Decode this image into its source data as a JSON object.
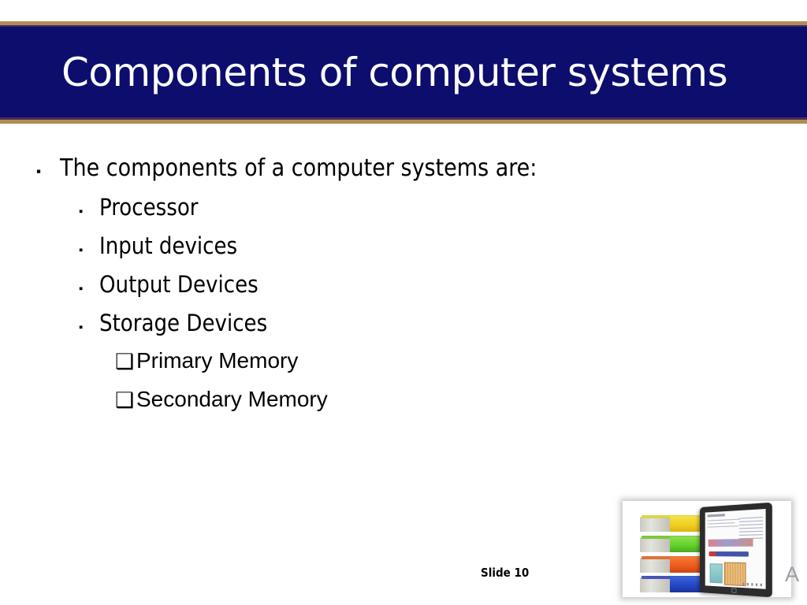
{
  "slide": {
    "title": "Components of computer systems",
    "slide_number_label": "Slide 10",
    "stray_letter": "A",
    "colors": {
      "banner_background": "#0d0d6e",
      "banner_border": "#b08d54",
      "title_text": "#ffffff",
      "body_text": "#000000",
      "slide_background": "#ffffff"
    }
  },
  "body": {
    "bullets": [
      {
        "level": 1,
        "marker": "square-bullet",
        "marker_glyph": "▪",
        "text": "The components of a computer systems are:"
      },
      {
        "level": 2,
        "marker": "square-bullet",
        "marker_glyph": "▪",
        "text": "Processor"
      },
      {
        "level": 2,
        "marker": "square-bullet",
        "marker_glyph": "▪",
        "text": "Input devices"
      },
      {
        "level": 2,
        "marker": "square-bullet",
        "marker_glyph": "▪",
        "text": "Output Devices"
      },
      {
        "level": 2,
        "marker": "square-bullet",
        "marker_glyph": "▪",
        "text": "Storage Devices"
      },
      {
        "level": 3,
        "marker": "shadowed-white-square-bullet",
        "marker_glyph": "❑",
        "text": "Primary Memory"
      },
      {
        "level": 3,
        "marker": "shadowed-white-square-bullet",
        "marker_glyph": "❑",
        "text": "Secondary Memory"
      }
    ]
  },
  "corner_image": {
    "description": "stack of books beside a tablet",
    "books": [
      {
        "name": "book-yellow",
        "color": "#f2cf20"
      },
      {
        "name": "book-green",
        "color": "#63d22c"
      },
      {
        "name": "book-orange",
        "color": "#ee5c1c"
      },
      {
        "name": "book-blue",
        "color": "#2346c9"
      }
    ],
    "tablet": {
      "bezel_color": "#2c2c2e",
      "screen_color": "#fbfbfb"
    }
  }
}
